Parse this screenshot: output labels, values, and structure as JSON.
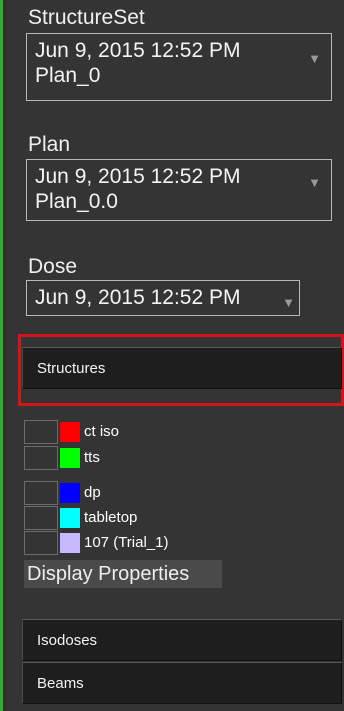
{
  "structure_set": {
    "label": "StructureSet",
    "date": "Jun 9, 2015 12:52 PM",
    "name": "Plan_0",
    "arrow": "▼"
  },
  "plan": {
    "label": "Plan",
    "date": "Jun 9, 2015 12:52 PM",
    "name": "Plan_0.0",
    "arrow": "▼"
  },
  "dose": {
    "label": "Dose",
    "date": "Jun 9, 2015 12:52 PM",
    "arrow": "▼"
  },
  "structures_header": "Structures",
  "structures": [
    {
      "name": "ct iso",
      "color": "#ff0000",
      "checked": false
    },
    {
      "name": "tts",
      "color": "#00ff00",
      "checked": false
    },
    {
      "name": "dp",
      "color": "#0000ff",
      "checked": false
    },
    {
      "name": "tabletop",
      "color": "#00ffff",
      "checked": false
    },
    {
      "name": "107 (Trial_1)",
      "color": "#c8b8ff",
      "checked": false
    }
  ],
  "display_properties": "Display Properties",
  "isodoses_header": "Isodoses",
  "beams_header": "Beams",
  "colors": {
    "highlight": "#d0151b",
    "accent_green": "#28b428",
    "panel_bg": "#343434"
  }
}
